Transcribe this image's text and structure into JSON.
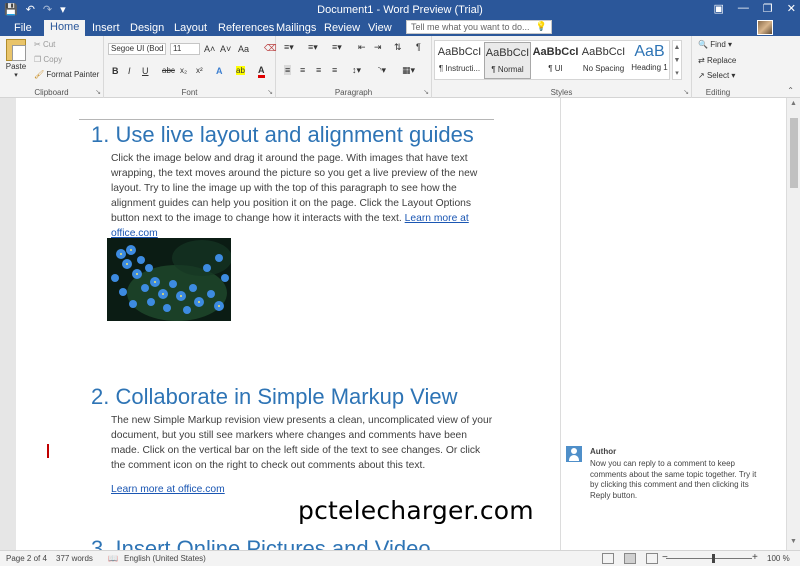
{
  "titlebar": {
    "title": "Document1 - Word Preview (Trial)",
    "qat": [
      "save-icon",
      "undo-icon",
      "redo-icon"
    ],
    "window_buttons": [
      "ribbon-options-icon",
      "minimize-icon",
      "restore-icon",
      "close-icon"
    ]
  },
  "tabs": [
    "File",
    "Home",
    "Insert",
    "Design",
    "Layout",
    "References",
    "Mailings",
    "Review",
    "View"
  ],
  "active_tab": "Home",
  "tellme_placeholder": "Tell me what you want to do...",
  "ribbon": {
    "clipboard": {
      "label": "Clipboard",
      "paste": "Paste",
      "cut": "Cut",
      "copy": "Copy",
      "format_painter": "Format Painter"
    },
    "font": {
      "label": "Font",
      "font_name": "Segoe UI (Bod",
      "font_size": "11",
      "bold": "B",
      "italic": "I",
      "underline": "U",
      "strike": "abc",
      "subscript": "x₂",
      "superscript": "x²",
      "grow": "A˄",
      "shrink": "A˅",
      "case": "Aa",
      "clear": "A̸",
      "effects": "A",
      "highlight": "ab",
      "color": "A"
    },
    "paragraph": {
      "label": "Paragraph"
    },
    "styles": {
      "label": "Styles",
      "items": [
        {
          "sample": "AaBbCcI",
          "name": "¶ Instructi..."
        },
        {
          "sample": "AaBbCcI",
          "name": "¶ Normal"
        },
        {
          "sample": "AaBbCcI",
          "name": "¶ UI"
        },
        {
          "sample": "AaBbCcI",
          "name": "No Spacing"
        },
        {
          "sample": "AaB",
          "name": "Heading 1"
        }
      ],
      "selected_index": 1
    },
    "editing": {
      "label": "Editing",
      "find": "Find",
      "replace": "Replace",
      "select": "Select"
    }
  },
  "document": {
    "sections": [
      {
        "number": "1.",
        "heading": "Use live layout and alignment guides",
        "body": "Click the image below and drag it around the page. With images that have text wrapping, the text moves around the picture so you get a live preview of the new layout. Try to line the image up with the top of this paragraph to see how the alignment guides can help you position it on the page.  Click the Layout Options button next to the image to change how it interacts with the text.",
        "link": "Learn more at office.com"
      },
      {
        "number": "2.",
        "heading": "Collaborate in Simple Markup View",
        "body": "The new Simple Markup revision view presents a clean, uncomplicated view of your document, but you still see markers where changes and comments have been made. Click on the vertical bar on the left side of the text to see changes. Or click the comment icon on the right to check out comments about this text.",
        "link": "Learn more at office.com"
      },
      {
        "number": "3.",
        "heading": "Insert Online Pictures and Video"
      }
    ]
  },
  "comment": {
    "author": "Author",
    "text": "Now you can reply to a comment to keep comments about the same topic together. Try it by clicking this comment and then clicking its Reply button."
  },
  "watermark": "pctelecharger.com",
  "statusbar": {
    "page": "Page 2 of 4",
    "words": "377 words",
    "language": "English (United States)",
    "zoom": "100 %",
    "zoom_minus": "−",
    "zoom_plus": "+"
  },
  "colors": {
    "accent": "#2b579a",
    "heading": "#2e74b5",
    "link": "#1a56b3",
    "change_bar": "#c00000"
  }
}
